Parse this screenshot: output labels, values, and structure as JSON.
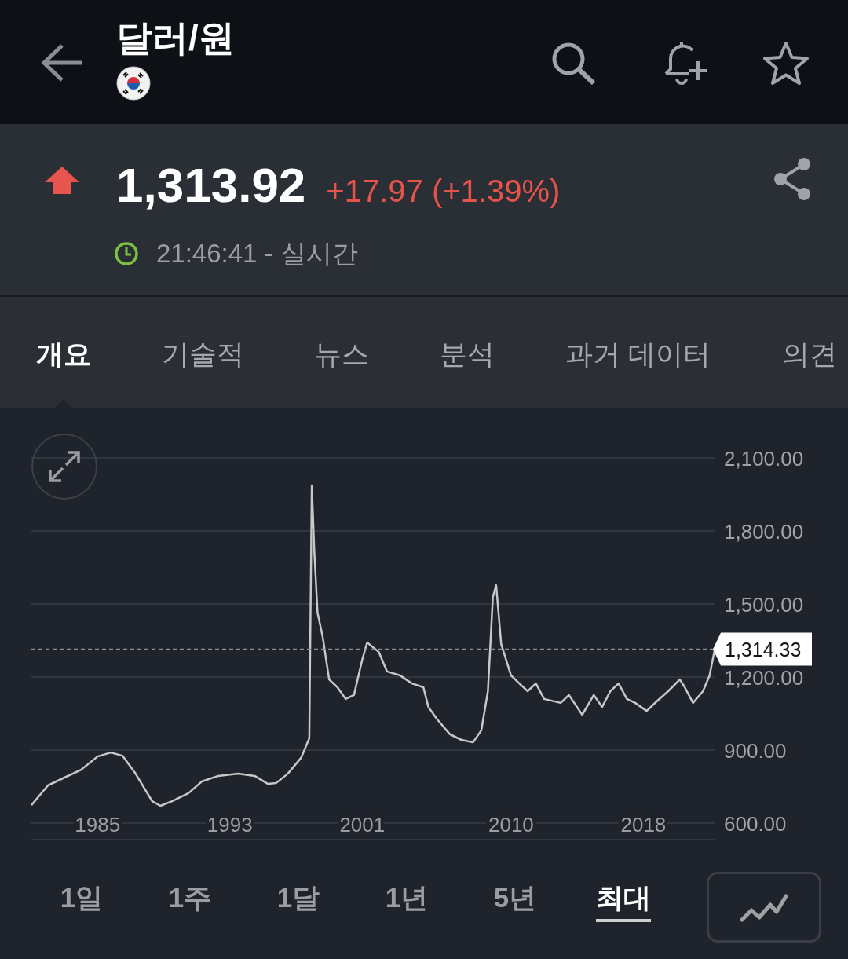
{
  "header": {
    "title": "달러/원"
  },
  "quote": {
    "rising": true,
    "price": "1,313.92",
    "change": "+17.97 (+1.39%)",
    "time": "21:46:41 - 실시간"
  },
  "tabs": [
    {
      "label": "개요",
      "selected": true
    },
    {
      "label": "기술적",
      "selected": false
    },
    {
      "label": "뉴스",
      "selected": false
    },
    {
      "label": "분석",
      "selected": false
    },
    {
      "label": "과거 데이터",
      "selected": false
    },
    {
      "label": "의견",
      "selected": false
    }
  ],
  "chart": {
    "chart_data": {
      "type": "line",
      "grid": true,
      "xlim": [
        1981,
        2022.3
      ],
      "ylim": [
        600,
        2100
      ],
      "xticks": [
        1985,
        1993,
        2001,
        2010,
        2018
      ],
      "yticks": [
        {
          "value": 2100,
          "label": "2,100.00"
        },
        {
          "value": 1800,
          "label": "1,800.00"
        },
        {
          "value": 1500,
          "label": "1,500.00"
        },
        {
          "value": 1200,
          "label": "1,200.00"
        },
        {
          "value": 900,
          "label": "900.00"
        },
        {
          "value": 600,
          "label": "600.00"
        }
      ],
      "x": [
        1981,
        1982,
        1983,
        1984,
        1985,
        1985.8,
        1986.5,
        1987.3,
        1988.3,
        1988.8,
        1989.5,
        1990.5,
        1991.3,
        1992.3,
        1993.5,
        1994.5,
        1995.3,
        1995.8,
        1996.5,
        1997.3,
        1997.8,
        1997.95,
        1998.1,
        1998.3,
        1998.6,
        1999,
        1999.5,
        2000,
        2000.5,
        2001,
        2001.3,
        2002,
        2002.5,
        2003.3,
        2004,
        2004.7,
        2005,
        2005.5,
        2006.3,
        2007,
        2007.7,
        2008.2,
        2008.6,
        2008.9,
        2009.1,
        2009.4,
        2010,
        2010.5,
        2011,
        2011.5,
        2012,
        2013,
        2013.5,
        2014.3,
        2015,
        2015.5,
        2016,
        2016.5,
        2017,
        2017.5,
        2018.2,
        2018.8,
        2019.5,
        2020.2,
        2020.5,
        2021,
        2021.6,
        2022,
        2022.3
      ],
      "series": [
        {
          "color": "#c8c8c8",
          "values": [
            674,
            755,
            787,
            819,
            874,
            890,
            877,
            803,
            690,
            671,
            690,
            723,
            771,
            794,
            803,
            794,
            761,
            765,
            803,
            868,
            948,
            1987,
            1723,
            1465,
            1368,
            1190,
            1158,
            1110,
            1126,
            1271,
            1342,
            1303,
            1223,
            1206,
            1174,
            1158,
            1077,
            1029,
            965,
            942,
            932,
            981,
            1142,
            1529,
            1577,
            1335,
            1206,
            1174,
            1142,
            1174,
            1110,
            1094,
            1126,
            1045,
            1126,
            1077,
            1142,
            1174,
            1110,
            1094,
            1061,
            1100,
            1142,
            1190,
            1158,
            1094,
            1142,
            1206,
            1309
          ]
        }
      ],
      "ref_lines": [
        {
          "axis": "y",
          "value": 1314.33,
          "label": "1,314.33"
        }
      ]
    }
  },
  "ranges": [
    {
      "label": "1일",
      "selected": false
    },
    {
      "label": "1주",
      "selected": false
    },
    {
      "label": "1달",
      "selected": false
    },
    {
      "label": "1년",
      "selected": false
    },
    {
      "label": "5년",
      "selected": false
    },
    {
      "label": "최대",
      "selected": true
    }
  ]
}
